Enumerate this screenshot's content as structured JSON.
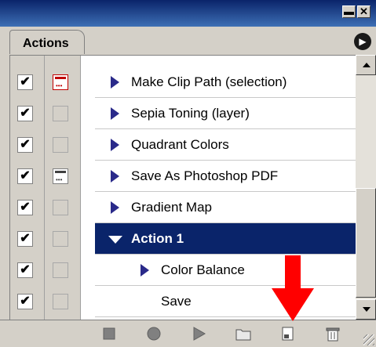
{
  "window": {
    "minimize_glyph": "▬",
    "close_glyph": "✕"
  },
  "panel": {
    "tab_label": "Actions",
    "menu_glyph": "▶"
  },
  "rows": [
    {
      "label": "Make Clip Path (selection)",
      "checked": true,
      "dialog": "red",
      "expanded": false,
      "indent": 0,
      "selected": false
    },
    {
      "label": "Sepia Toning (layer)",
      "checked": true,
      "dialog": "none",
      "expanded": false,
      "indent": 0,
      "selected": false
    },
    {
      "label": "Quadrant Colors",
      "checked": true,
      "dialog": "none",
      "expanded": false,
      "indent": 0,
      "selected": false
    },
    {
      "label": "Save As Photoshop PDF",
      "checked": true,
      "dialog": "on",
      "expanded": false,
      "indent": 0,
      "selected": false
    },
    {
      "label": "Gradient Map",
      "checked": true,
      "dialog": "none",
      "expanded": false,
      "indent": 0,
      "selected": false
    },
    {
      "label": "Action 1",
      "checked": true,
      "dialog": "none",
      "expanded": true,
      "indent": 0,
      "selected": true
    },
    {
      "label": "Color Balance",
      "checked": true,
      "dialog": "none",
      "expanded": false,
      "indent": 1,
      "selected": false
    },
    {
      "label": "Save",
      "checked": true,
      "dialog": "none",
      "expanded": null,
      "indent": 2,
      "selected": false
    }
  ],
  "toolbar": {
    "buttons": [
      "stop-icon",
      "record-icon",
      "play-icon",
      "new-set-icon",
      "new-action-icon",
      "delete-icon"
    ]
  },
  "colors": {
    "selection": "#0a246a",
    "arrow": "#ff0000",
    "triangle": "#2a2a8a"
  }
}
